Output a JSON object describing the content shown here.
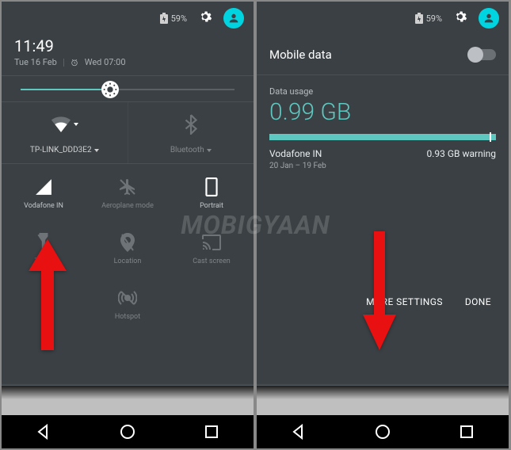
{
  "watermark": "MOBIGYAAN",
  "left": {
    "battery_pct": "59%",
    "time": "11:49",
    "date": "Tue 16 Feb",
    "alarm": "Wed 07:00",
    "wifi_label": "TP-LINK_DDD3E2",
    "bt_label": "Bluetooth",
    "tiles": {
      "signal": "Vodafone IN",
      "airplane": "Aeroplane mode",
      "portrait": "Portrait",
      "torch": "Torch",
      "location": "Location",
      "cast": "Cast screen",
      "hotspot": "Hotspot"
    }
  },
  "right": {
    "battery_pct": "59%",
    "title": "Mobile data",
    "usage_label": "Data usage",
    "usage_value": "0.99 GB",
    "carrier": "Vodafone IN",
    "warning": "0.93 GB warning",
    "period": "20 Jan – 19 Feb",
    "more_settings": "MORE SETTINGS",
    "done": "DONE"
  }
}
